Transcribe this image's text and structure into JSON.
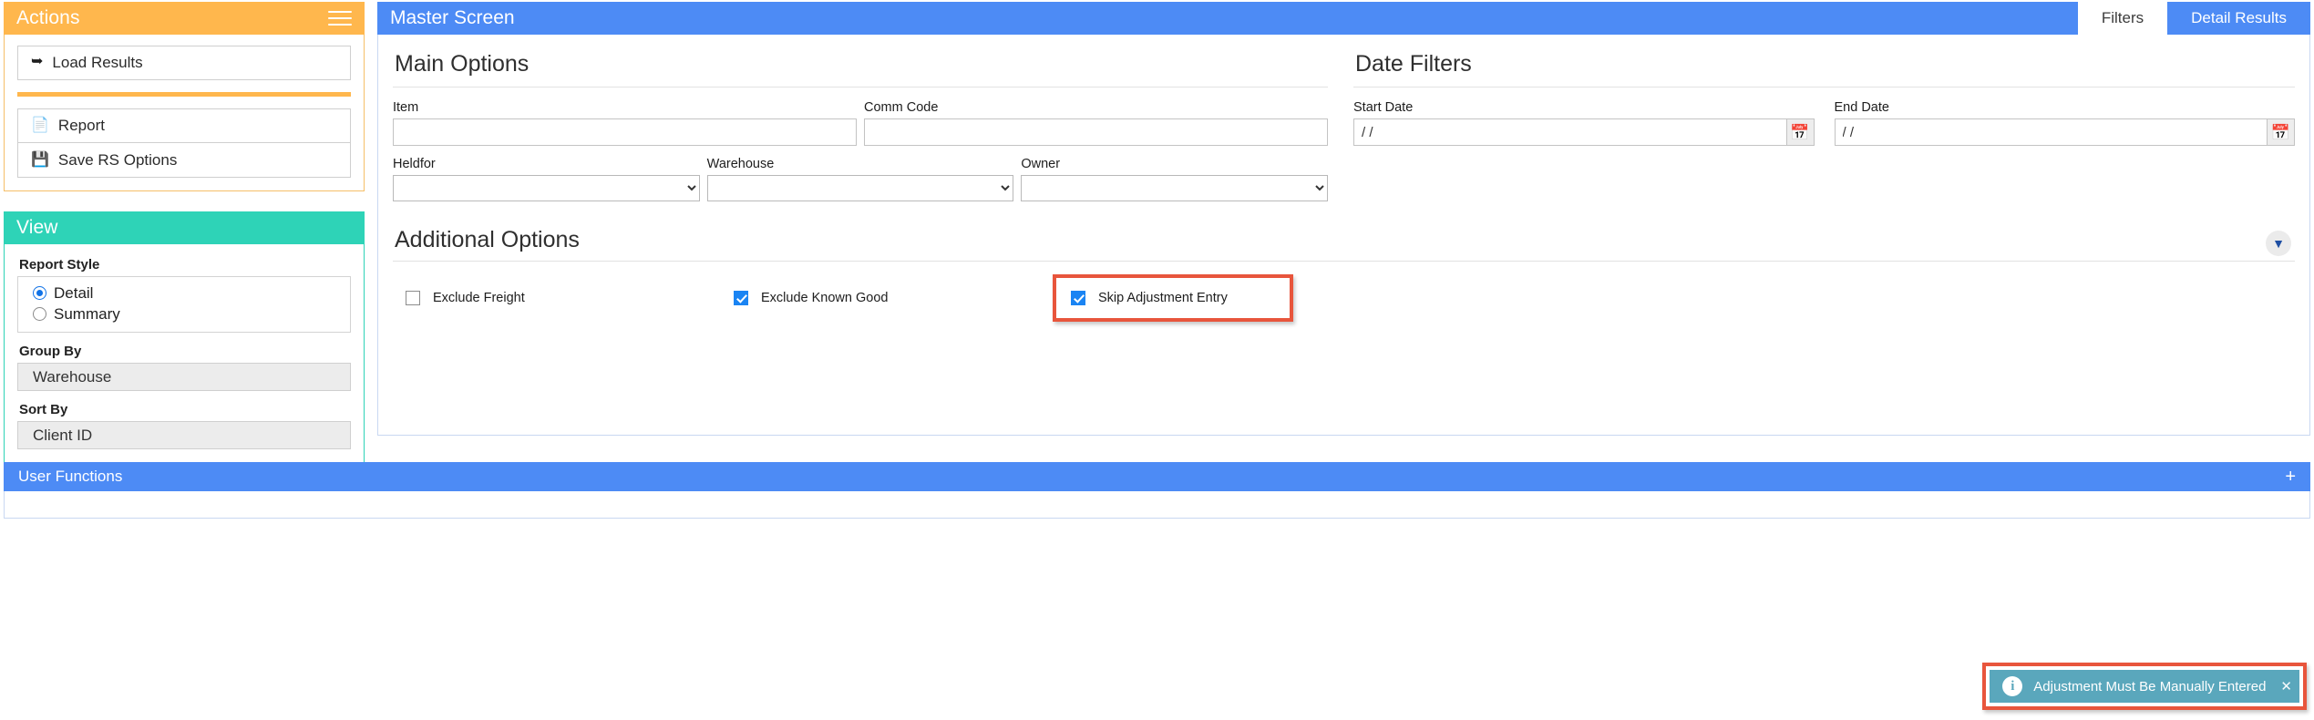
{
  "actions_panel": {
    "title": "Actions",
    "menu_icon": "hamburger-icon",
    "primary": {
      "label": "Load Results",
      "icon": "share-arrow-icon"
    },
    "secondary": [
      {
        "label": "Report",
        "icon": "document-icon"
      },
      {
        "label": "Save RS Options",
        "icon": "floppy-disk-icon"
      }
    ]
  },
  "view_panel": {
    "title": "View",
    "report_style": {
      "label": "Report Style",
      "options": [
        {
          "label": "Detail",
          "selected": true
        },
        {
          "label": "Summary",
          "selected": false
        }
      ]
    },
    "group_by": {
      "label": "Group By",
      "value": "Warehouse"
    },
    "sort_by": {
      "label": "Sort By",
      "value": "Client ID"
    }
  },
  "master": {
    "title": "Master Screen",
    "tabs": [
      {
        "label": "Filters",
        "active": true
      },
      {
        "label": "Detail Results",
        "active": false
      }
    ],
    "main_options": {
      "title": "Main Options",
      "fields": [
        {
          "label": "Item",
          "value": "",
          "placeholder": ""
        },
        {
          "label": "Comm Code",
          "value": "",
          "placeholder": ""
        }
      ],
      "dropdowns": [
        {
          "label": "Heldfor",
          "value": ""
        },
        {
          "label": "Warehouse",
          "value": ""
        },
        {
          "label": "Owner",
          "value": ""
        }
      ]
    },
    "date_filters": {
      "title": "Date Filters",
      "fields": [
        {
          "label": "Start Date",
          "value": "/ /",
          "calendar_icon": "calendar-icon"
        },
        {
          "label": "End Date",
          "value": "/ /",
          "calendar_icon": "calendar-icon"
        }
      ]
    },
    "additional_options": {
      "title": "Additional Options",
      "collapse_icon": "chevron-down-icon",
      "checkboxes": [
        {
          "label": "Exclude Freight",
          "checked": false,
          "highlighted": false
        },
        {
          "label": "Exclude Known Good",
          "checked": true,
          "highlighted": false
        },
        {
          "label": "Skip Adjustment Entry",
          "checked": true,
          "highlighted": true
        }
      ]
    }
  },
  "user_functions": {
    "title": "User Functions",
    "expand_icon": "plus-icon"
  },
  "toast": {
    "message": "Adjustment Must Be Manually Entered",
    "icon": "info-icon",
    "close_icon": "close-icon"
  },
  "colors": {
    "actions_header": "#ffb74d",
    "view_header": "#2ed3b7",
    "blue_header": "#4d8bf5",
    "highlight": "#e8553c",
    "toast_bg": "#5aa7bc",
    "checkbox_on": "#1a84f3"
  }
}
